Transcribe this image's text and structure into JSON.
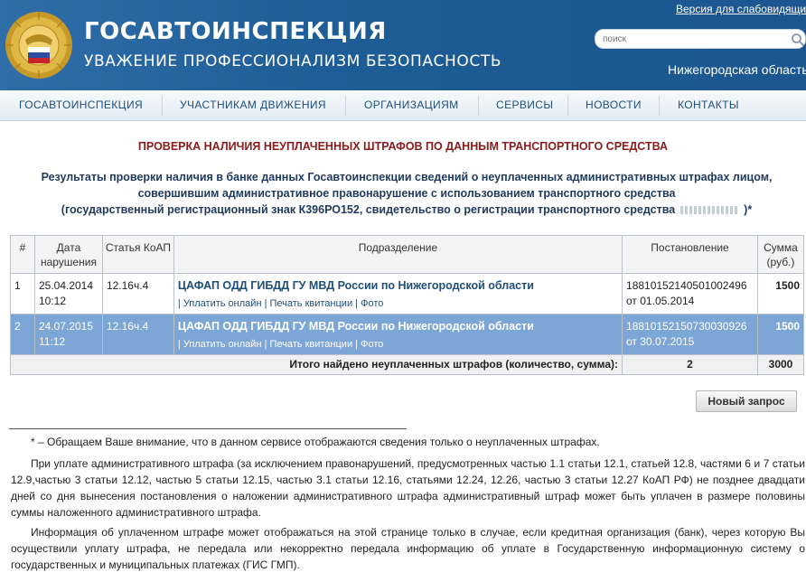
{
  "header": {
    "title": "ГОСАВТОИНСПЕКЦИЯ",
    "slogan": "УВАЖЕНИЕ  ПРОФЕССИОНАЛИЗМ  БЕЗОПАСНОСТЬ",
    "accessible_link": "Версия для слабовидящих",
    "search_placeholder": "поиск",
    "region": "Нижегородская область"
  },
  "nav": {
    "items": [
      "ГОСАВТОИНСПЕКЦИЯ",
      "УЧАСТНИКАМ ДВИЖЕНИЯ",
      "ОРГАНИЗАЦИЯМ",
      "СЕРВИСЫ",
      "НОВОСТИ",
      "КОНТАКТЫ"
    ]
  },
  "page": {
    "heading": "ПРОВЕРКА НАЛИЧИЯ НЕУПЛАЧЕННЫХ ШТРАФОВ ПО ДАННЫМ ТРАНСПОРТНОГО СРЕДСТВА",
    "intro_line1": "Результаты проверки наличия в банке данных Госавтоинспекции сведений о неуплаченных административных штрафах лицом,",
    "intro_line2": "совершившим административное правонарушение с использованием транспортного средства",
    "intro_line3_start": "(государственный регистрационный знак К396РО152, свидетельство о регистрации транспортного средства",
    "intro_line3_end": ")*"
  },
  "table": {
    "headers": {
      "num": "#",
      "date": "Дата нарушения",
      "article": "Статья КоАП",
      "unit": "Подразделение",
      "decree": "Постановление",
      "amount": "Сумма (руб.)"
    },
    "rows": [
      {
        "num": "1",
        "date": "25.04.2014",
        "time": "10:12",
        "article": "12.16ч.4",
        "unit": "ЦАФАП ОДД ГИБДД ГУ МВД России по Нижегородской области",
        "pay_online": "Уплатить онлайн",
        "print_receipt": "Печать квитанции",
        "photo": "Фото",
        "decree_no": "18810152140501002496",
        "decree_date": "от 01.05.2014",
        "amount": "1500"
      },
      {
        "num": "2",
        "date": "24.07.2015",
        "time": "11:12",
        "article": "12.16ч.4",
        "unit": "ЦАФАП ОДД ГИБДД ГУ МВД России по Нижегородской области",
        "pay_online": "Уплатить онлайн",
        "print_receipt": "Печать квитанции",
        "photo": "Фото",
        "decree_no": "18810152150730030926",
        "decree_date": "от 30.07.2015",
        "amount": "1500"
      }
    ],
    "total_label": "Итого найдено неуплаченных штрафов (количество, сумма):",
    "total_count": "2",
    "total_sum": "3000"
  },
  "new_request_label": "Новый запрос",
  "notes": {
    "star": "* – Обращаем Ваше внимание, что в данном сервисе отображаются сведения только о неуплаченных штрафах.",
    "p1": "При уплате административного штрафа (за исключением правонарушений, предусмотренных частью 1.1 статьи 12.1, статьей 12.8, частями 6 и 7 статьи 12.9,частью 3 статьи 12.12, частью 5 статьи 12.15, частью 3.1 статьи 12.16, статьями 12.24, 12.26, частью 3 статьи 12.27 КоАП РФ) не позднее двадцати дней со дня вынесения постановления о наложении административного штрафа административный штраф может быть уплачен в размере половины суммы наложенного административного штрафа.",
    "p2": "Информация об уплаченном штрафе может отображаться на этой странице только в случае, если кредитная организация (банк), через которую Вы осуществили уплату штрафа, не передала или некорректно передала информацию об уплате в Государственную информационную систему о государственных и муниципальных платежах (ГИС ГМП)."
  },
  "colors": {
    "header_bg": "#1d5a93",
    "nav_text": "#1f4e79",
    "heading_red": "#8b1a1a",
    "selected_row": "#7ca6d6"
  },
  "icons": [
    "police-emblem-icon",
    "search-icon"
  ]
}
